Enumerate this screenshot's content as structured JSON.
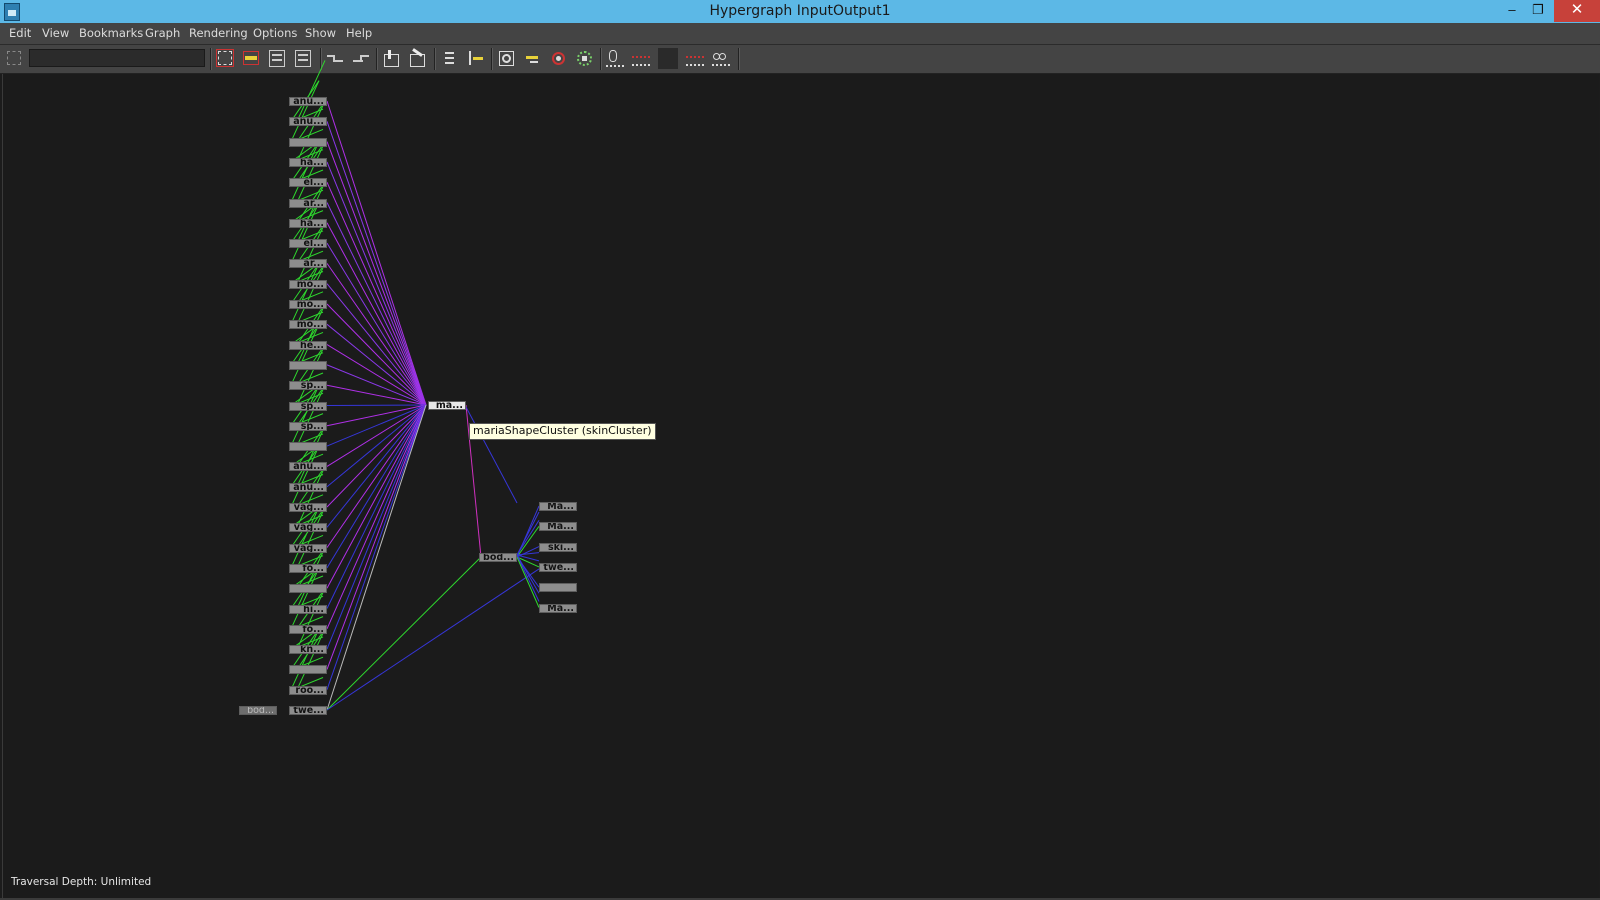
{
  "window": {
    "title": "Hypergraph InputOutput1",
    "minimize": "–",
    "restore": "❐",
    "close": "✕"
  },
  "menu": [
    "Edit",
    "View",
    "Bookmarks",
    "Graph",
    "Rendering",
    "Options",
    "Show",
    "Help"
  ],
  "toolbar": {
    "search_value": "",
    "buttons": [
      "frame-all-icon",
      "frame-selection-icon",
      "previous-view-icon",
      "next-view-icon",
      "scene-hierarchy-icon",
      "input-output-icon",
      "add-node-icon",
      "remove-node-icon",
      "graph-list-icon",
      "layout-icon",
      "refresh-icon",
      "toggle-swatch-icon",
      "radial-icon",
      "zero-level-icon",
      "clear-connection-icon",
      "blank-swatch-icon",
      "break-connection-icon",
      "infinite-icon"
    ]
  },
  "colors": {
    "accent": "#5cb8e6",
    "wire_purple": "#b030e8",
    "wire_blue": "#3636d8",
    "wire_green": "#2ed82e",
    "close": "#c7413a"
  },
  "graph": {
    "left_column": [
      "anu...",
      "anu...",
      "",
      "ha...",
      "el...",
      "ar...",
      "ha...",
      "el...",
      "ar...",
      "mo...",
      "mo...",
      "mo...",
      "he...",
      "",
      "sp...",
      "sp...",
      "sp...",
      "",
      "anu...",
      "anu...",
      "vag...",
      "vag...",
      "vag...",
      "fo...",
      "",
      "hi...",
      "fo...",
      "kn...",
      "",
      "roo..."
    ],
    "tweak_node": "twe...",
    "faded_node": "bod...",
    "cluster_node": "ma...",
    "body_node": "bod...",
    "right_column": [
      "Ma...",
      "Ma...",
      "ski...",
      "twe...",
      "",
      "Ma..."
    ],
    "tooltip": "mariaShapeCluster (skinCluster)"
  },
  "status": {
    "text": "Traversal Depth: Unlimited"
  }
}
